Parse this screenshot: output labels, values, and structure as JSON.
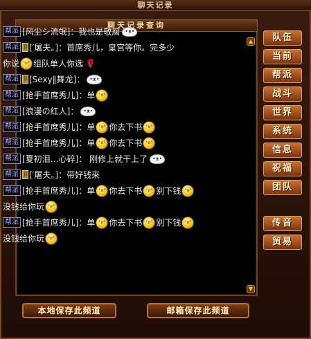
{
  "window": {
    "title": "聊天记录"
  },
  "panel": {
    "title": "聊天记录查询"
  },
  "messages": [
    {
      "badge": "帮派",
      "npc": false,
      "text": "[风尘シ流氓]：我也是敬腐",
      "emotes": [
        "blob"
      ]
    },
    {
      "badge": "帮派",
      "npc": true,
      "text": "[′屠夫。]：首席秀儿，皇宫等你。完多少",
      "emotes": []
    },
    {
      "badge": "",
      "npc": false,
      "text": "你说",
      "tail": "组队单人你选",
      "emotes": [
        "face",
        "rose"
      ]
    },
    {
      "badge": "帮派",
      "npc": true,
      "text": "[Sexy‖舞龙]：",
      "emotes": [
        "blob"
      ]
    },
    {
      "badge": "帮派",
      "npc": false,
      "text": "[抢手首席秀儿]：单",
      "emotes": [
        "face"
      ]
    },
    {
      "badge": "帮派",
      "npc": false,
      "text": "[浪漫の红人]：",
      "emotes": [
        "blob"
      ]
    },
    {
      "badge": "帮派",
      "npc": false,
      "text": "[抢手首席秀儿]：单",
      "tail": "你去下书",
      "emotes": [
        "face",
        "face"
      ]
    },
    {
      "badge": "帮派",
      "npc": false,
      "text": "[抢手首席秀儿]：单",
      "tail": "你去下书",
      "emotes": [
        "face",
        "face"
      ]
    },
    {
      "badge": "帮派",
      "npc": false,
      "text": "[夏初泪…心碎]： 刚修上就干上了",
      "emotes": [
        "blob"
      ]
    },
    {
      "badge": "帮派",
      "npc": true,
      "text": "[′屠夫。]：带好钱来",
      "emotes": []
    },
    {
      "badge": "帮派",
      "npc": false,
      "text": "[抢手首席秀儿]：单",
      "tail": "你去下书",
      "tail2": "别下钱",
      "emotes": [
        "face",
        "face",
        "face"
      ]
    },
    {
      "badge": "",
      "npc": false,
      "text": "没钱给你玩",
      "emotes": [
        "face"
      ]
    },
    {
      "badge": "帮派",
      "npc": false,
      "text": "[抢手首席秀儿]：单",
      "tail": "你去下书",
      "tail2": "别下钱",
      "emotes": [
        "face",
        "face",
        "face"
      ]
    },
    {
      "badge": "",
      "npc": false,
      "text": "没钱给你玩",
      "emotes": [
        "face"
      ]
    }
  ],
  "sidebar": {
    "buttons": [
      "队伍",
      "当前",
      "帮派",
      "战斗",
      "世界",
      "系统",
      "信息",
      "祝福",
      "团队"
    ],
    "extra": [
      "传音",
      "贸易"
    ]
  },
  "bottom": {
    "save_local": "本地保存此频道",
    "save_mail": "邮箱保存此频道"
  }
}
